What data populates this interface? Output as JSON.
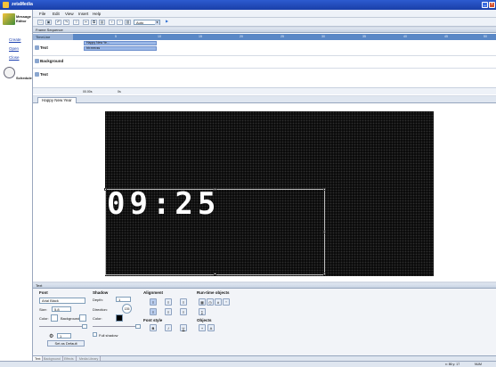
{
  "window": {
    "title": "zetaMedia"
  },
  "left_pane": {
    "section_title": "Message Editor",
    "links": [
      "Create",
      "Open",
      "Close"
    ],
    "schedule_label": "Schedule"
  },
  "menu": [
    "File",
    "Edit",
    "View",
    "Insert",
    "Help"
  ],
  "toolbar": {
    "auto_value": "Auto"
  },
  "sequence": {
    "header": "Frame Sequence",
    "timeline_label": "TimeLine",
    "ruler_marks": [
      "5",
      "10",
      "15",
      "20",
      "25",
      "30",
      "35",
      "40",
      "45",
      "50"
    ],
    "tracks": [
      {
        "label": "Text"
      },
      {
        "label": "Background"
      },
      {
        "label": "Text"
      }
    ],
    "clips": [
      "Happy New Ye...",
      "hh:mm:ss"
    ],
    "footer_time": "00.00s",
    "footer_val": "0s"
  },
  "editor": {
    "tab": "Happy New Year",
    "clock_text": "09:25"
  },
  "text_panel": {
    "header": "Text",
    "font": {
      "title": "Font",
      "name": "Arial Black",
      "size_label": "Size:",
      "size_value": "5.8",
      "color_label": "Color:",
      "background_label": "Background:",
      "spin_value": "1",
      "default_button": "Set as Default"
    },
    "shadow": {
      "title": "Shadow",
      "depth_label": "Depth:",
      "depth_value": "1",
      "direction_label": "Direction:",
      "direction_value": "135",
      "color_label": "Color:",
      "full_label": "Full shadow"
    },
    "alignment": {
      "title": "Alignment"
    },
    "font_style": {
      "title": "Font style",
      "buttons": [
        "B",
        "I",
        "U"
      ]
    },
    "runtime": {
      "title": "Run-time objects"
    },
    "objects": {
      "title": "Objects"
    }
  },
  "bottom_tabs": [
    "Text",
    "Background",
    "Effects",
    "Media Library"
  ],
  "status": {
    "coords": "x: 86   y: 17",
    "mode": "NUM"
  }
}
